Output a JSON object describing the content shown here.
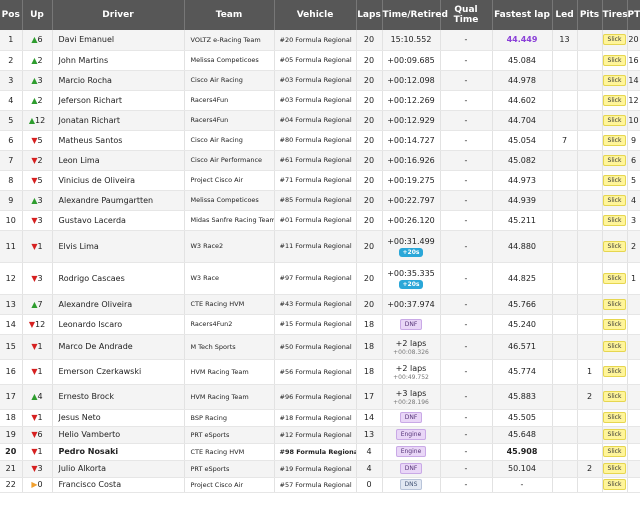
{
  "headers": {
    "pos": "Pos",
    "up": "Up",
    "driver": "Driver",
    "team": "Team",
    "vehicle": "Vehicle",
    "laps": "Laps",
    "time": "Time/Retired",
    "qual": "Qual Time",
    "fastest": "Fastest lap",
    "led": "Led",
    "pits": "Pits",
    "tires": "Tires",
    "pts": "PTS"
  },
  "colors": {
    "header_bg": "#575757",
    "up": "#2e9d2e",
    "down": "#d62020",
    "best_lap": "#8a3fd8",
    "tire_badge": "#fff59a",
    "penalty_badge": "#2aa7d8"
  },
  "rows": [
    {
      "pos": "1",
      "dir": "up",
      "arrow": "▲",
      "delta": "6",
      "driver": "Davi Emanuel",
      "team": "VOLTZ e-Racing Team",
      "vehicle": "#20 Formula Regional",
      "laps": "20",
      "time": "15:10.552",
      "time_sub": "",
      "penalty": "",
      "status": "",
      "qual": "-",
      "fastest": "44.449",
      "best": true,
      "led": "13",
      "pits": "",
      "tires": "Slick",
      "pts": "20"
    },
    {
      "pos": "2",
      "dir": "up",
      "arrow": "▲",
      "delta": "2",
      "driver": "John Martins",
      "team": "Melissa Competicoes",
      "vehicle": "#05 Formula Regional",
      "laps": "20",
      "time": "+00:09.685",
      "time_sub": "",
      "penalty": "",
      "status": "",
      "qual": "-",
      "fastest": "45.084",
      "best": false,
      "led": "",
      "pits": "",
      "tires": "Slick",
      "pts": "16"
    },
    {
      "pos": "3",
      "dir": "up",
      "arrow": "▲",
      "delta": "3",
      "driver": "Marcio Rocha",
      "team": "Cisco Air Racing",
      "vehicle": "#03 Formula Regional",
      "laps": "20",
      "time": "+00:12.098",
      "time_sub": "",
      "penalty": "",
      "status": "",
      "qual": "-",
      "fastest": "44.978",
      "best": false,
      "led": "",
      "pits": "",
      "tires": "Slick",
      "pts": "14"
    },
    {
      "pos": "4",
      "dir": "up",
      "arrow": "▲",
      "delta": "2",
      "driver": "Jeferson Richart",
      "team": "Racers4Fun",
      "vehicle": "#03 Formula Regional",
      "laps": "20",
      "time": "+00:12.269",
      "time_sub": "",
      "penalty": "",
      "status": "",
      "qual": "-",
      "fastest": "44.602",
      "best": false,
      "led": "",
      "pits": "",
      "tires": "Slick",
      "pts": "12"
    },
    {
      "pos": "5",
      "dir": "up",
      "arrow": "▲",
      "delta": "12",
      "driver": "Jonatan Richart",
      "team": "Racers4Fun",
      "vehicle": "#04 Formula Regional",
      "laps": "20",
      "time": "+00:12.929",
      "time_sub": "",
      "penalty": "",
      "status": "",
      "qual": "-",
      "fastest": "44.704",
      "best": false,
      "led": "",
      "pits": "",
      "tires": "Slick",
      "pts": "10"
    },
    {
      "pos": "6",
      "dir": "down",
      "arrow": "▼",
      "delta": "5",
      "driver": "Matheus Santos",
      "team": "Cisco Air Racing",
      "vehicle": "#80 Formula Regional",
      "laps": "20",
      "time": "+00:14.727",
      "time_sub": "",
      "penalty": "",
      "status": "",
      "qual": "-",
      "fastest": "45.054",
      "best": false,
      "led": "7",
      "pits": "",
      "tires": "Slick",
      "pts": "9"
    },
    {
      "pos": "7",
      "dir": "down",
      "arrow": "▼",
      "delta": "2",
      "driver": "Leon Lima",
      "team": "Cisco Air Performance",
      "vehicle": "#61 Formula Regional",
      "laps": "20",
      "time": "+00:16.926",
      "time_sub": "",
      "penalty": "",
      "status": "",
      "qual": "-",
      "fastest": "45.082",
      "best": false,
      "led": "",
      "pits": "",
      "tires": "Slick",
      "pts": "6"
    },
    {
      "pos": "8",
      "dir": "down",
      "arrow": "▼",
      "delta": "5",
      "driver": "Vinicius de Oliveira",
      "team": "Project Cisco Air",
      "vehicle": "#71 Formula Regional",
      "laps": "20",
      "time": "+00:19.275",
      "time_sub": "",
      "penalty": "",
      "status": "",
      "qual": "-",
      "fastest": "44.973",
      "best": false,
      "led": "",
      "pits": "",
      "tires": "Slick",
      "pts": "5"
    },
    {
      "pos": "9",
      "dir": "up",
      "arrow": "▲",
      "delta": "3",
      "driver": "Alexandre Paumgartten",
      "team": "Melissa Competicoes",
      "vehicle": "#85 Formula Regional",
      "laps": "20",
      "time": "+00:22.797",
      "time_sub": "",
      "penalty": "",
      "status": "",
      "qual": "-",
      "fastest": "44.939",
      "best": false,
      "led": "",
      "pits": "",
      "tires": "Slick",
      "pts": "4"
    },
    {
      "pos": "10",
      "dir": "down",
      "arrow": "▼",
      "delta": "3",
      "driver": "Gustavo Lacerda",
      "team": "Midas Sanfre Racing Team",
      "vehicle": "#01 Formula Regional",
      "laps": "20",
      "time": "+00:26.120",
      "time_sub": "",
      "penalty": "",
      "status": "",
      "qual": "-",
      "fastest": "45.211",
      "best": false,
      "led": "",
      "pits": "",
      "tires": "Slick",
      "pts": "3"
    },
    {
      "pos": "11",
      "dir": "down",
      "arrow": "▼",
      "delta": "1",
      "driver": "Elvis Lima",
      "team": "W3 Race2",
      "vehicle": "#11 Formula Regional",
      "laps": "20",
      "time": "+00:31.499",
      "time_sub": "",
      "penalty": "+20s",
      "status": "",
      "qual": "-",
      "fastest": "44.880",
      "best": false,
      "led": "",
      "pits": "",
      "tires": "Slick",
      "pts": "2"
    },
    {
      "pos": "12",
      "dir": "down",
      "arrow": "▼",
      "delta": "3",
      "driver": "Rodrigo Cascaes",
      "team": "W3 Race",
      "vehicle": "#97 Formula Regional",
      "laps": "20",
      "time": "+00:35.335",
      "time_sub": "",
      "penalty": "+20s",
      "status": "",
      "qual": "-",
      "fastest": "44.825",
      "best": false,
      "led": "",
      "pits": "",
      "tires": "Slick",
      "pts": "1"
    },
    {
      "pos": "13",
      "dir": "up",
      "arrow": "▲",
      "delta": "7",
      "driver": "Alexandre Oliveira",
      "team": "CTE Racing HVM",
      "vehicle": "#43 Formula Regional",
      "laps": "20",
      "time": "+00:37.974",
      "time_sub": "",
      "penalty": "",
      "status": "",
      "qual": "-",
      "fastest": "45.766",
      "best": false,
      "led": "",
      "pits": "",
      "tires": "Slick",
      "pts": ""
    },
    {
      "pos": "14",
      "dir": "down",
      "arrow": "▼",
      "delta": "12",
      "driver": "Leonardo Iscaro",
      "team": "Racers4Fun2",
      "vehicle": "#15 Formula Regional",
      "laps": "18",
      "time": "",
      "time_sub": "",
      "penalty": "",
      "status": "DNF",
      "qual": "-",
      "fastest": "45.240",
      "best": false,
      "led": "",
      "pits": "",
      "tires": "Slick",
      "pts": ""
    },
    {
      "pos": "15",
      "dir": "down",
      "arrow": "▼",
      "delta": "1",
      "driver": "Marco De Andrade",
      "team": "M Tech Sports",
      "vehicle": "#50 Formula Regional",
      "laps": "18",
      "time": "+2 laps",
      "time_sub": "+00:08.326",
      "penalty": "",
      "status": "",
      "qual": "-",
      "fastest": "46.571",
      "best": false,
      "led": "",
      "pits": "",
      "tires": "Slick",
      "pts": ""
    },
    {
      "pos": "16",
      "dir": "down",
      "arrow": "▼",
      "delta": "1",
      "driver": "Emerson Czerkawski",
      "team": "HVM Racing Team",
      "vehicle": "#56 Formula Regional",
      "laps": "18",
      "time": "+2 laps",
      "time_sub": "+00:49.752",
      "penalty": "",
      "status": "",
      "qual": "-",
      "fastest": "45.774",
      "best": false,
      "led": "",
      "pits": "1",
      "tires": "Slick",
      "pts": ""
    },
    {
      "pos": "17",
      "dir": "up",
      "arrow": "▲",
      "delta": "4",
      "driver": "Ernesto Brock",
      "team": "HVM Racing Team",
      "vehicle": "#96 Formula Regional",
      "laps": "17",
      "time": "+3 laps",
      "time_sub": "+00:28.196",
      "penalty": "",
      "status": "",
      "qual": "-",
      "fastest": "45.883",
      "best": false,
      "led": "",
      "pits": "2",
      "tires": "Slick",
      "pts": ""
    },
    {
      "pos": "18",
      "dir": "down",
      "arrow": "▼",
      "delta": "1",
      "driver": "Jesus Neto",
      "team": "BSP Racing",
      "vehicle": "#18 Formula Regional",
      "laps": "14",
      "time": "",
      "time_sub": "",
      "penalty": "",
      "status": "DNF",
      "qual": "-",
      "fastest": "45.505",
      "best": false,
      "led": "",
      "pits": "",
      "tires": "Slick",
      "pts": ""
    },
    {
      "pos": "19",
      "dir": "down",
      "arrow": "▼",
      "delta": "6",
      "driver": "Helio Vamberto",
      "team": "PRT eSports",
      "vehicle": "#12 Formula Regional",
      "laps": "13",
      "time": "",
      "time_sub": "",
      "penalty": "",
      "status": "Engine",
      "qual": "-",
      "fastest": "45.648",
      "best": false,
      "led": "",
      "pits": "",
      "tires": "Slick",
      "pts": ""
    },
    {
      "pos": "20",
      "dir": "down",
      "arrow": "▼",
      "delta": "1",
      "driver": "Pedro Nosaki",
      "team": "CTE Racing HVM",
      "vehicle": "#98 Formula Regional",
      "laps": "4",
      "time": "",
      "time_sub": "",
      "penalty": "",
      "status": "Engine",
      "qual": "-",
      "fastest": "45.908",
      "best": false,
      "led": "",
      "pits": "",
      "tires": "Slick",
      "pts": "",
      "bold": true
    },
    {
      "pos": "21",
      "dir": "down",
      "arrow": "▼",
      "delta": "3",
      "driver": "Julio Alkorta",
      "team": "PRT eSports",
      "vehicle": "#19 Formula Regional",
      "laps": "4",
      "time": "",
      "time_sub": "",
      "penalty": "",
      "status": "DNF",
      "qual": "-",
      "fastest": "50.104",
      "best": false,
      "led": "",
      "pits": "2",
      "tires": "Slick",
      "pts": ""
    },
    {
      "pos": "22",
      "dir": "eq",
      "arrow": "▶",
      "delta": "0",
      "driver": "Francisco Costa",
      "team": "Project Cisco Air",
      "vehicle": "#57 Formula Regional",
      "laps": "0",
      "time": "",
      "time_sub": "",
      "penalty": "",
      "status": "DNS",
      "qual": "-",
      "fastest": "-",
      "best": false,
      "led": "",
      "pits": "",
      "tires": "Slick",
      "pts": ""
    }
  ]
}
